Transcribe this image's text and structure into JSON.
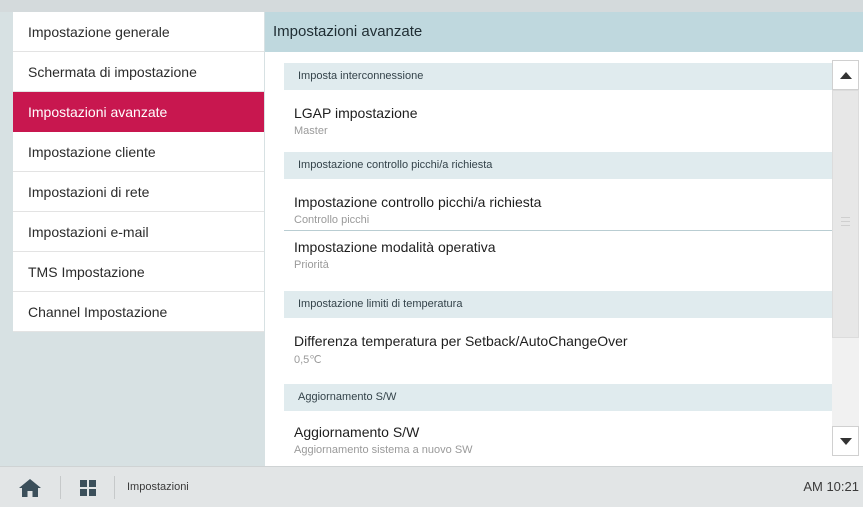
{
  "sidebar": {
    "items": [
      {
        "label": "Impostazione generale",
        "active": false
      },
      {
        "label": "Schermata di impostazione",
        "active": false
      },
      {
        "label": "Impostazioni avanzate",
        "active": true
      },
      {
        "label": "Impostazione cliente",
        "active": false
      },
      {
        "label": "Impostazioni di rete",
        "active": false
      },
      {
        "label": "Impostazioni e-mail",
        "active": false
      },
      {
        "label": "TMS Impostazione",
        "active": false
      },
      {
        "label": "Channel Impostazione",
        "active": false
      }
    ]
  },
  "header": {
    "title": "Impostazioni avanzate"
  },
  "sections": [
    {
      "header": "Imposta interconnessione",
      "items": [
        {
          "title": "LGAP impostazione",
          "value": "Master"
        }
      ]
    },
    {
      "header": "Impostazione controllo picchi/a richiesta",
      "items": [
        {
          "title": "Impostazione controllo picchi/a richiesta",
          "value": "Controllo picchi"
        },
        {
          "title": "Impostazione modalità operativa",
          "value": "Priorità"
        }
      ]
    },
    {
      "header": "Impostazione limiti di temperatura",
      "items": [
        {
          "title": "Differenza temperatura per Setback/AutoChangeOver",
          "value": "0,5℃"
        }
      ]
    },
    {
      "header": "Aggiornamento S/W",
      "items": [
        {
          "title": "Aggiornamento S/W",
          "value": "Aggiornamento sistema a nuovo SW"
        }
      ]
    }
  ],
  "scrollbar": {
    "position": 0.0
  },
  "bottom_bar": {
    "home_icon": "home-icon",
    "apps_icon": "grid-icon",
    "breadcrumb": "Impostazioni",
    "time": "AM 10:21"
  },
  "colors": {
    "accent": "#c8174f",
    "header_bg": "#bfd8de",
    "section_bg": "#e0ebee",
    "sidebar_bg": "#d7e1e3"
  }
}
